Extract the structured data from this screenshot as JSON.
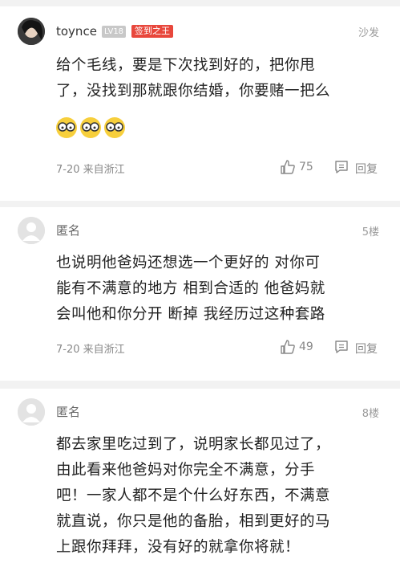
{
  "comments": [
    {
      "username": "toynce",
      "level": "LV18",
      "badge": "签到之王",
      "floor": "沙发",
      "content_lines": [
        "给个毛线，要是下次找到好的，把你甩",
        "了，没找到那就跟你结婚，你要赌一把么"
      ],
      "emoji": [
        "glasses-face-emoji",
        "glasses-face-emoji",
        "glasses-face-emoji"
      ],
      "meta": "7-20 来自浙江",
      "likes": "75",
      "reply_label": "回复"
    },
    {
      "username": "匿名",
      "floor": "5楼",
      "content_lines": [
        "也说明他爸妈还想选一个更好的 对你可",
        "能有不满意的地方 相到合适的 他爸妈就",
        "会叫他和你分开 断掉 我经历过这种套路"
      ],
      "meta": "7-20 来自浙江",
      "likes": "49",
      "reply_label": "回复"
    },
    {
      "username": "匿名",
      "floor": "8楼",
      "content_lines": [
        "都去家里吃过到了，说明家长都见过了，",
        "由此看来他爸妈对你完全不满意，分手",
        "吧！一家人都不是个什么好东西，不满意",
        "就直说，你只是他的备胎，相到更好的马",
        "上跟你拜拜，没有好的就拿你将就！"
      ]
    }
  ],
  "colors": {
    "badge_red": "#e8473c",
    "page_bg": "#f2f2f2",
    "meta_gray": "#888888"
  }
}
